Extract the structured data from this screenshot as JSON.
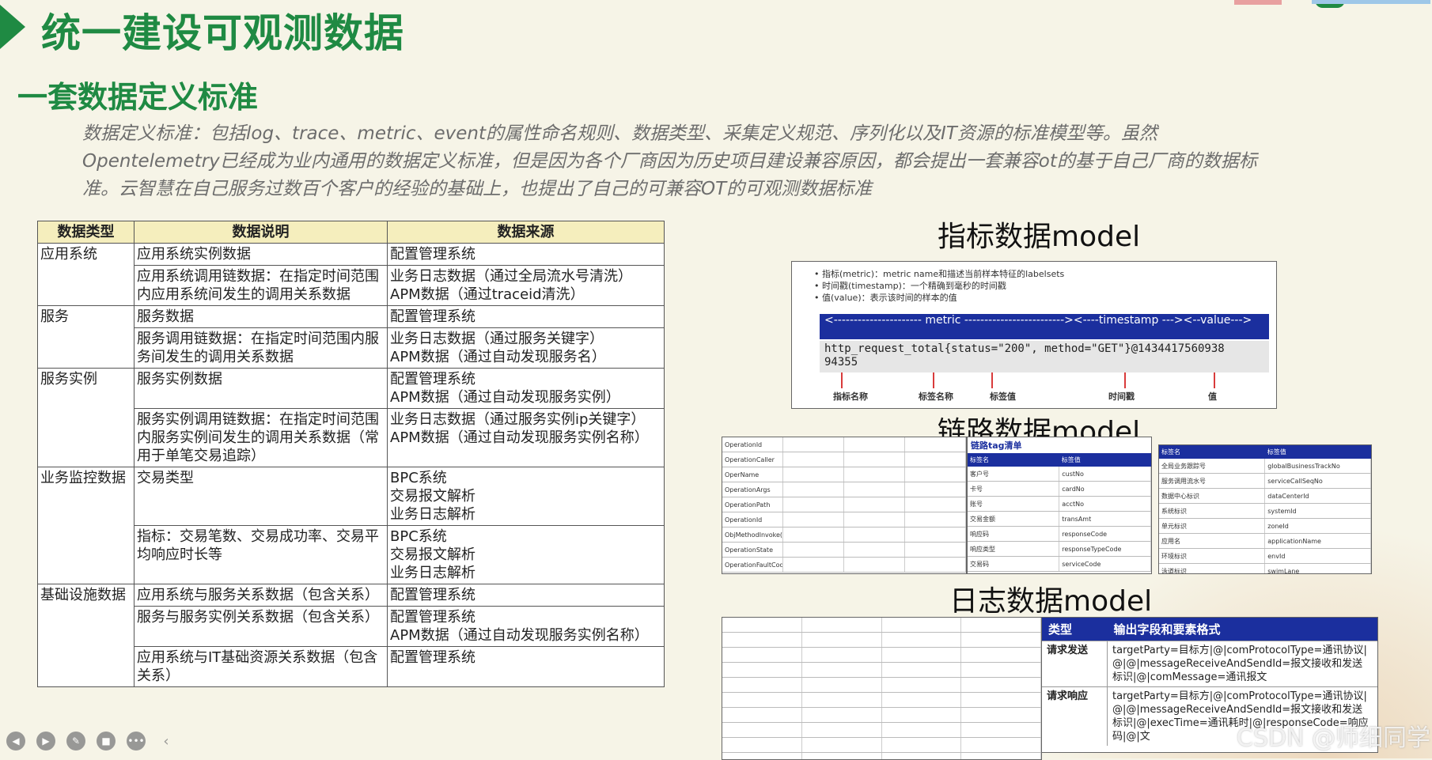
{
  "header": {
    "title": "统一建设可观测数据"
  },
  "section": {
    "subtitle": "一套数据定义标准",
    "description": "数据定义标准：包括log、trace、metric、event的属性命名规则、数据类型、采集定义规范、序列化以及IT资源的标准模型等。虽然Opentelemetry已经成为业内通用的数据定义标准，但是因为各个厂商因为历史项目建设兼容原因，都会提出一套兼容ot的基于自己厂商的数据标准。云智慧在自己服务过数百个客户的经验的基础上，也提出了自己的可兼容OT的可观测数据标准"
  },
  "data_table": {
    "headers": [
      "数据类型",
      "数据说明",
      "数据来源"
    ],
    "groups": [
      {
        "category": "应用系统",
        "rows": [
          {
            "desc": "应用系统实例数据",
            "source": "配置管理系统"
          },
          {
            "desc": "应用系统调用链数据：在指定时间范围内应用系统间发生的调用关系数据",
            "source": "业务日志数据（通过全局流水号清洗）\nAPM数据（通过traceid清洗）"
          }
        ]
      },
      {
        "category": "服务",
        "rows": [
          {
            "desc": "服务数据",
            "source": "配置管理系统"
          },
          {
            "desc": "服务调用链数据：在指定时间范围内服务间发生的调用关系数据",
            "source": "业务日志数据（通过服务关键字）\nAPM数据（通过自动发现服务名）"
          }
        ]
      },
      {
        "category": "服务实例",
        "rows": [
          {
            "desc": "服务实例数据",
            "source": "配置管理系统\nAPM数据（通过自动发现服务实例）"
          },
          {
            "desc": "服务实例调用链数据：在指定时间范围内服务实例间发生的调用关系数据（常用于单笔交易追踪）",
            "source": "业务日志数据（通过服务实例ip关键字）\nAPM数据（通过自动发现服务实例名称）"
          }
        ]
      },
      {
        "category": "业务监控数据",
        "rows": [
          {
            "desc": "交易类型",
            "source": "BPC系统\n交易报文解析\n业务日志解析"
          },
          {
            "desc": "指标：交易笔数、交易成功率、交易平均响应时长等",
            "source": "BPC系统\n交易报文解析\n业务日志解析"
          }
        ]
      },
      {
        "category": "基础设施数据",
        "rows": [
          {
            "desc": "应用系统与服务关系数据（包含关系）",
            "source": "配置管理系统"
          },
          {
            "desc": "服务与服务实例关系数据（包含关系）",
            "source": "配置管理系统\nAPM数据（通过自动发现服务实例名称）"
          },
          {
            "desc": "应用系统与IT基础资源关系数据（包含关系）",
            "source": "配置管理系统"
          }
        ]
      }
    ]
  },
  "metric_model": {
    "title": "指标数据model",
    "bullets": [
      "指标(metric)：metric name和描述当前样本特征的labelsets",
      "时间戳(timestamp)：一个精确到毫秒的时间戳",
      "值(value)：表示该时间的样本的值"
    ],
    "bar_text": "<---------------------- metric -------------------------><----timestamp ---><--value--->",
    "sample": "http_request_total{status=\"200\", method=\"GET\"}@1434417560938 94355",
    "labels": [
      "指标名称",
      "标签名称",
      "标签值",
      "时间戳",
      "值"
    ]
  },
  "trace_model": {
    "title": "链路数据model",
    "left_rows": [
      "Operationld",
      "OperationCaller",
      "OperName",
      "OperationArgs",
      "OperationPath",
      "OperationId",
      "ObjMethodInvoke(Param)",
      "OperationState",
      "OperationFaultCode"
    ],
    "mid_caption": "链路tag清单",
    "mid_header": [
      "标签名",
      "标签值"
    ],
    "mid_rows": [
      [
        "客户号",
        "custNo"
      ],
      [
        "卡号",
        "cardNo"
      ],
      [
        "账号",
        "acctNo"
      ],
      [
        "交易金额",
        "transAmt"
      ],
      [
        "响应码",
        "responseCode"
      ],
      [
        "响应类型",
        "responseTypeCode"
      ],
      [
        "交易码",
        "serviceCode"
      ]
    ],
    "right_header": [
      "标签名",
      "标签值"
    ],
    "right_rows": [
      [
        "全局业务跟踪号",
        "globalBusinessTrackNo"
      ],
      [
        "服务调用流水号",
        "serviceCallSeqNo"
      ],
      [
        "数据中心标识",
        "dataCenterId"
      ],
      [
        "系统标识",
        "systemId"
      ],
      [
        "单元标识",
        "zoneId"
      ],
      [
        "应用名",
        "applicationName"
      ],
      [
        "环境标识",
        "envId"
      ],
      [
        "泳道标识",
        "swimLane"
      ]
    ]
  },
  "log_model": {
    "title": "日志数据model",
    "right_header": [
      "类型",
      "输出字段和要素格式"
    ],
    "right_rows": [
      {
        "type": "请求发送",
        "text": "targetParty=目标方|@|comProtocolType=通讯协议|@|@|messageReceiveAndSendId=报文接收和发送标识|@|comMessage=通讯报文"
      },
      {
        "type": "请求响应",
        "text": "targetParty=目标方|@|comProtocolType=通讯协议|@|@|messageReceiveAndSendId=报文接收和发送标识|@|execTime=通讯耗时|@|responseCode=响应码|@|文"
      }
    ]
  },
  "watermark": "CSDN @师细同学"
}
